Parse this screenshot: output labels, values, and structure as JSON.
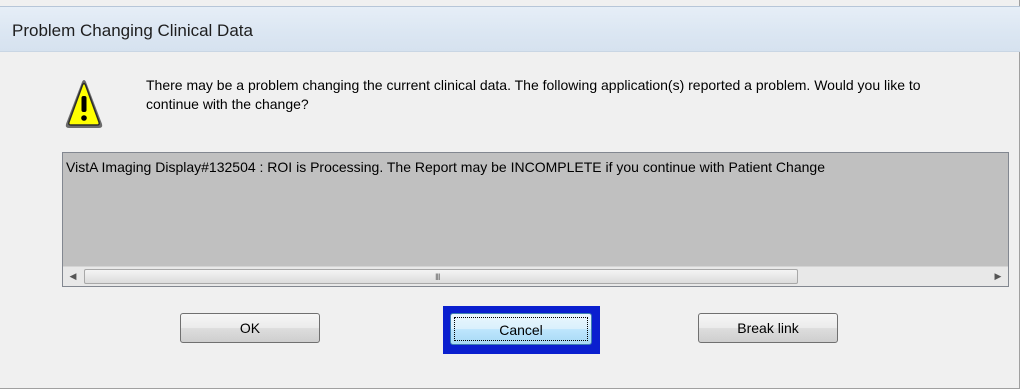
{
  "dialog": {
    "title": "Problem Changing Clinical Data",
    "message": "There may be a problem changing the current clinical data.  The following application(s) reported a problem.  Would you like to continue with the change?",
    "icon": "warning-icon"
  },
  "list": {
    "items": [
      "VistA Imaging Display#132504 : ROI is Processing. The Report may be INCOMPLETE if you continue with Patient Change"
    ]
  },
  "buttons": {
    "ok": "OK",
    "cancel": "Cancel",
    "break_link": "Break link"
  },
  "colors": {
    "focus_ring": "#0a1fcf",
    "list_background": "#c0c0c0",
    "warning_fill": "#ffff00"
  }
}
